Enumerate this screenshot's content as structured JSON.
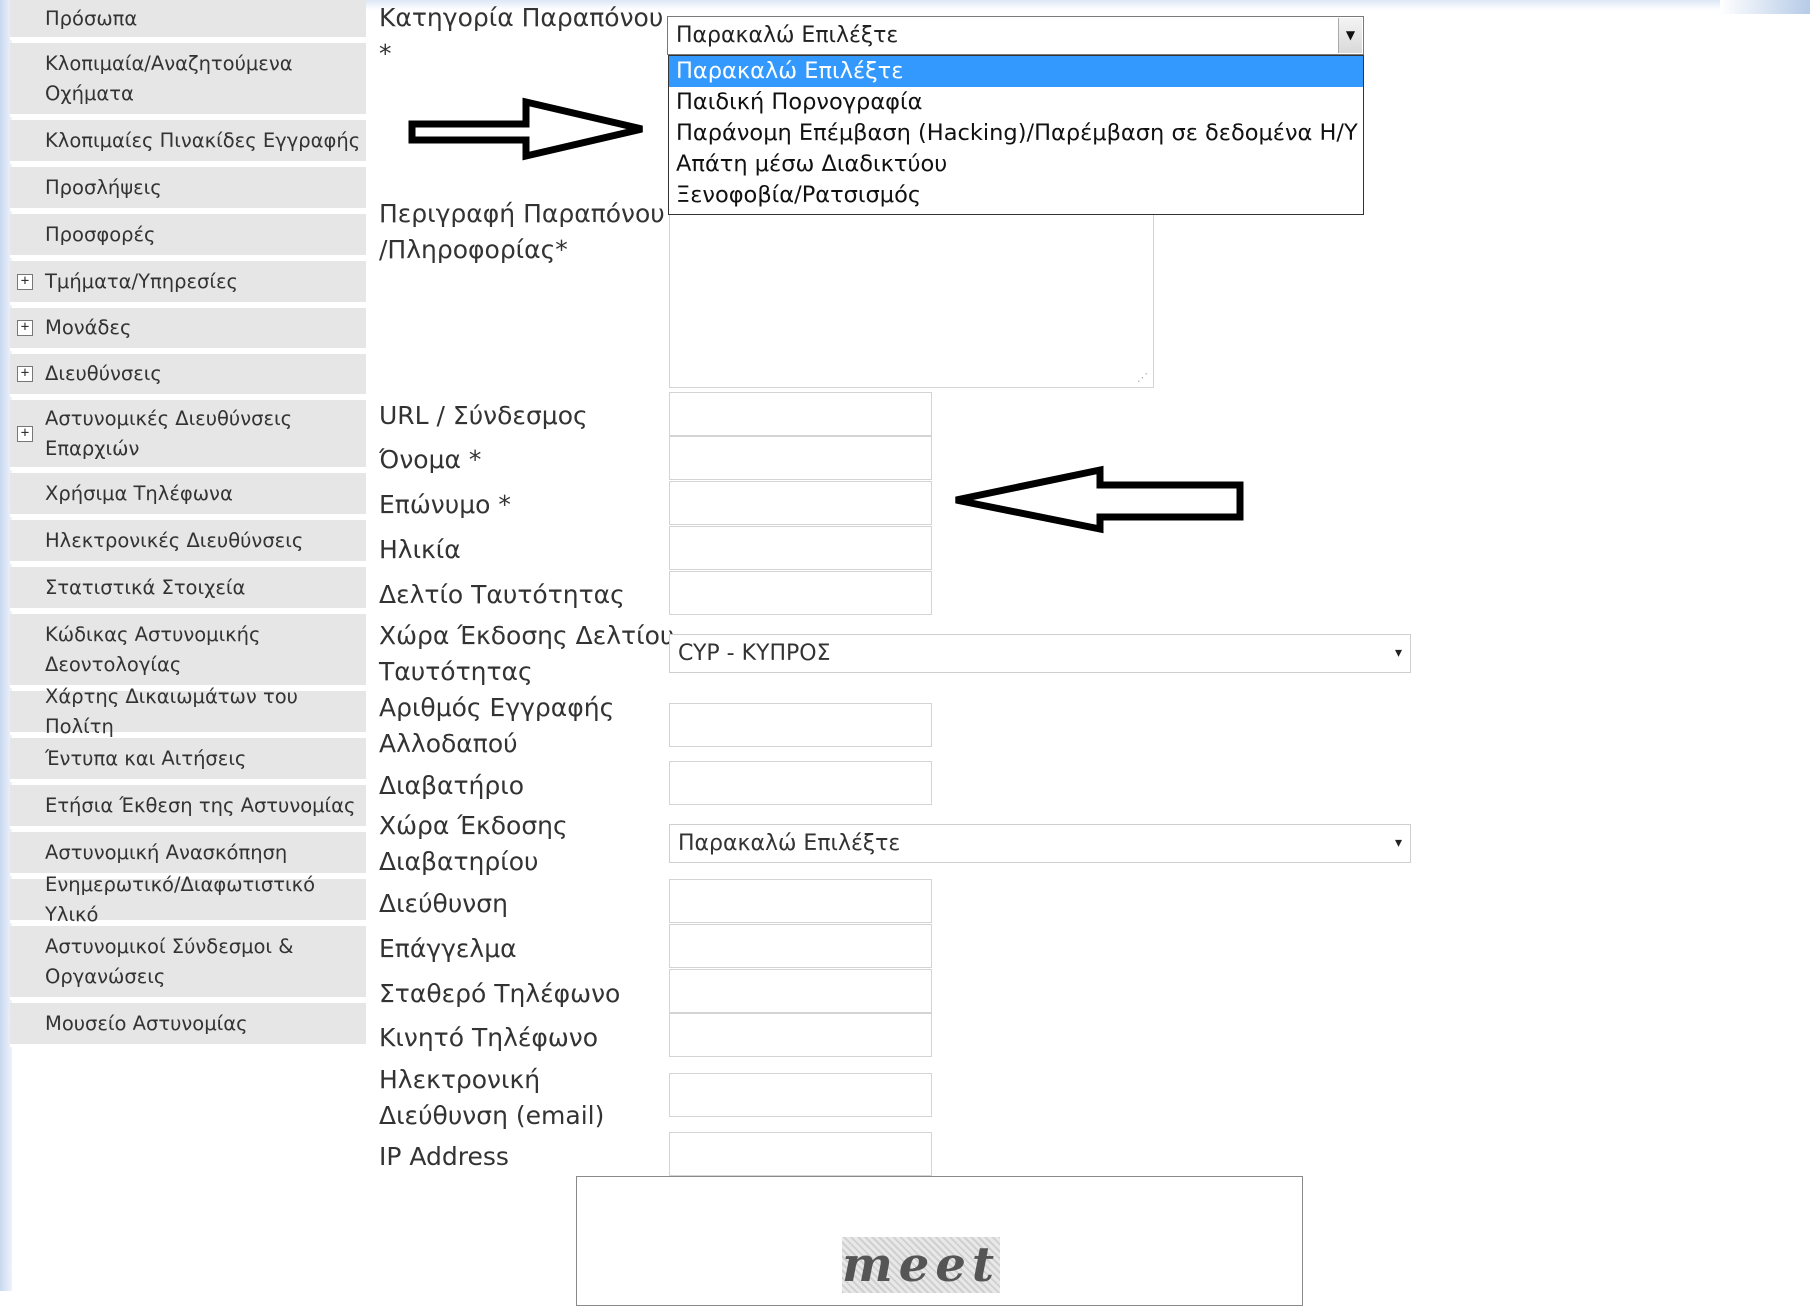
{
  "sidebar": {
    "items": [
      {
        "label": "Πρόσωπα",
        "expandable": false
      },
      {
        "label": "Κλοπιμαία/Αναζητούμενα\nΟχήματα",
        "expandable": false
      },
      {
        "label": "Κλοπιμαίες Πινακίδες Εγγραφής",
        "expandable": false
      },
      {
        "label": "Προσλήψεις",
        "expandable": false
      },
      {
        "label": "Προσφορές",
        "expandable": false
      },
      {
        "label": "Τμήματα/Υπηρεσίες",
        "expandable": true
      },
      {
        "label": "Μονάδες",
        "expandable": true
      },
      {
        "label": "Διευθύνσεις",
        "expandable": true
      },
      {
        "label": "Αστυνομικές Διευθύνσεις\nΕπαρχιών",
        "expandable": true
      },
      {
        "label": "Χρήσιμα Τηλέφωνα",
        "expandable": false
      },
      {
        "label": "Ηλεκτρονικές Διευθύνσεις",
        "expandable": false
      },
      {
        "label": "Στατιστικά Στοιχεία",
        "expandable": false
      },
      {
        "label": "Κώδικας Αστυνομικής\nΔεοντολογίας",
        "expandable": false
      },
      {
        "label": "Χάρτης Δικαιωμάτων του Πολίτη",
        "expandable": false
      },
      {
        "label": "Έντυπα και Αιτήσεις",
        "expandable": false
      },
      {
        "label": "Ετήσια Έκθεση της Αστυνομίας",
        "expandable": false
      },
      {
        "label": "Αστυνομική Ανασκόπηση",
        "expandable": false
      },
      {
        "label": "Ενημερωτικό/Διαφωτιστικό Υλικό",
        "expandable": false
      },
      {
        "label": "Αστυνομικοί Σύνδεσμοι &\nΟργανώσεις",
        "expandable": false
      },
      {
        "label": "Μουσείο Αστυνομίας",
        "expandable": false
      }
    ],
    "expand_symbol": "+"
  },
  "form": {
    "category": {
      "label": "Κατηγορία Παραπόνου\n*",
      "selected": "Παρακαλώ Επιλέξτε",
      "options": [
        "Παρακαλώ Επιλέξτε",
        "Παιδική Πορνογραφία",
        "Παράνομη Επέμβαση (Hacking)/Παρέμβαση σε δεδομένα Η/Υ",
        "Απάτη μέσω Διαδικτύου",
        "Ξενοφοβία/Ρατσισμός"
      ],
      "highlighted_index": 0
    },
    "description_label": "Περιγραφή Παραπόνου\n/Πληροφορίας*",
    "fields": {
      "url": "URL / Σύνδεσμος",
      "first_name": "Όνομα *",
      "last_name": "Επώνυμο *",
      "age": "Ηλικία",
      "id_card": "Δελτίο Ταυτότητας",
      "id_country": "Χώρα Έκδοσης Δελτίου\nΤαυτότητας",
      "alien_reg": "Αριθμός Εγγραφής\nΑλλοδαπού",
      "passport": "Διαβατήριο",
      "passport_country": "Χώρα Έκδοσης\nΔιαβατηρίου",
      "address": "Διεύθυνση",
      "profession": "Επάγγελμα",
      "landline": "Σταθερό Τηλέφωνο",
      "mobile": "Κινητό Τηλέφωνο",
      "email": "Ηλεκτρονική\nΔιεύθυνση (email)",
      "ip": "IP Address"
    },
    "id_country_value": "CYP - ΚΥΠΡΟΣ",
    "passport_country_value": "Παρακαλώ Επιλέξτε"
  },
  "captcha": {
    "word": "meet"
  },
  "icons": {
    "select_arrow": "▼",
    "small_arrow": "▾"
  }
}
